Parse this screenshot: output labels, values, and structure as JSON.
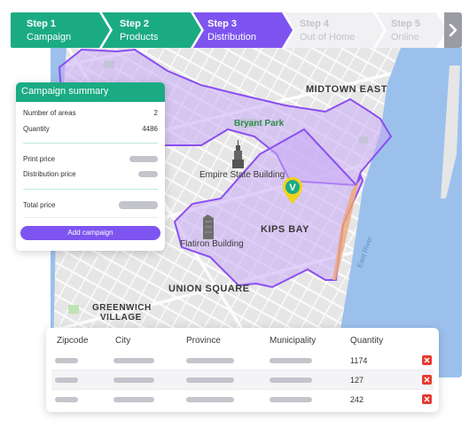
{
  "stepper": {
    "steps": [
      {
        "num": "Step 1",
        "label": "Campaign",
        "state": "done"
      },
      {
        "num": "Step 2",
        "label": "Products",
        "state": "done"
      },
      {
        "num": "Step 3",
        "label": "Distribution",
        "state": "active"
      },
      {
        "num": "Step 4",
        "label": "Out of Home",
        "state": "todo"
      },
      {
        "num": "Step 5",
        "label": "Online",
        "state": "todo"
      }
    ],
    "next_icon": "chevron-right-icon"
  },
  "map": {
    "labels": {
      "midtown_east": "MIDTOWN EAST",
      "bryant_park": "Bryant Park",
      "empire_state": "Empire State Building",
      "kips_bay": "KIPS BAY",
      "flatiron": "Flatiron Building",
      "union_square": "UNION SQUARE",
      "greenwich_1": "GREENWICH",
      "greenwich_2": "VILLAGE",
      "east_river": "East River"
    },
    "pin_letter": "V",
    "colors": {
      "area_fill": "#c9a9f6",
      "area_stroke": "#8a4ef0",
      "water": "#9cc0ec",
      "land": "#e9e9e9",
      "park": "#bfe3b4"
    }
  },
  "summary": {
    "title": "Campaign summary",
    "number_of_areas_label": "Number of areas",
    "number_of_areas_value": "2",
    "quantity_label": "Quantity",
    "quantity_value": "4486",
    "print_price_label": "Print price",
    "distribution_price_label": "Distribution price",
    "total_price_label": "Total price",
    "add_button": "Add campaign"
  },
  "table": {
    "headers": [
      "Zipcode",
      "City",
      "Province",
      "Municipality",
      "Quantity"
    ],
    "rows": [
      {
        "quantity": "1174"
      },
      {
        "quantity": "127"
      },
      {
        "quantity": "242"
      }
    ]
  },
  "colors": {
    "green": "#1bab82",
    "purple": "#7e54f0",
    "danger": "#e53a2f"
  }
}
